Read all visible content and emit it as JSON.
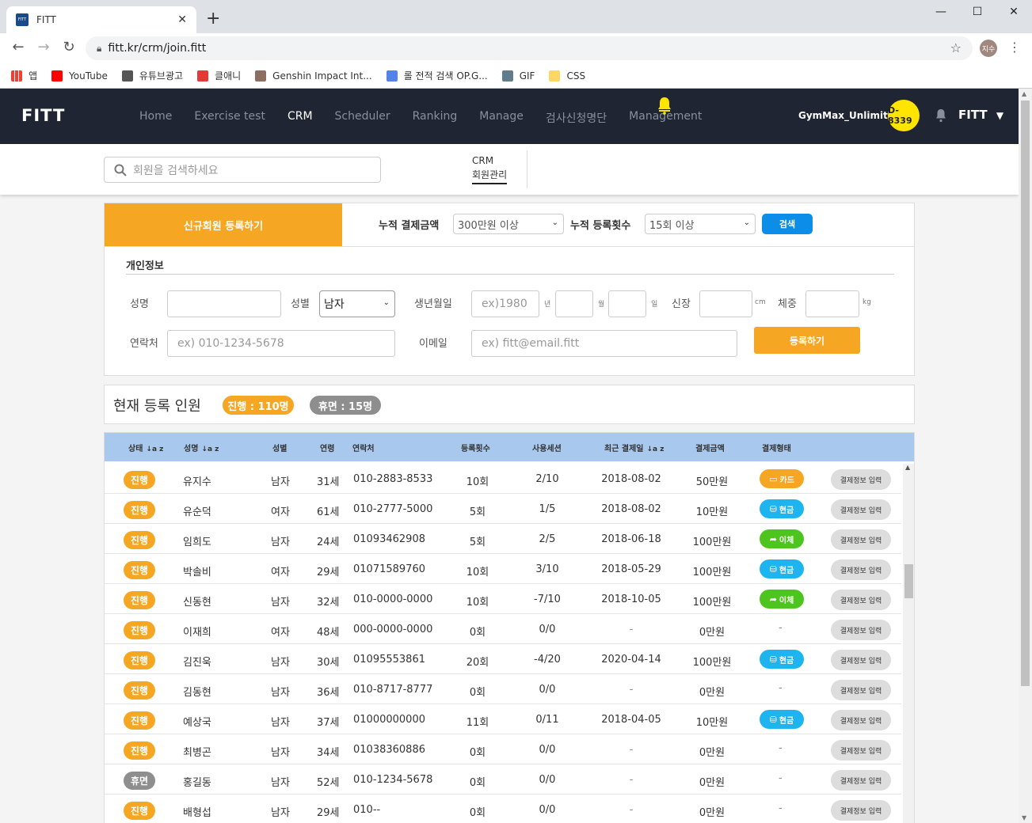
{
  "browser": {
    "tab_title": "FITT",
    "tab_favicon": "FITT",
    "url": "fitt.kr/crm/join.fitt",
    "profile": "지수",
    "bookmarks": [
      {
        "label": "앱",
        "icon": "apps-grid-icon",
        "color": "#4285f4"
      },
      {
        "label": "YouTube",
        "icon": "youtube-icon",
        "color": "#ff0000"
      },
      {
        "label": "유튜브광고",
        "icon": "globe-icon",
        "color": "#555555"
      },
      {
        "label": "클애니",
        "icon": "c-logo-icon",
        "color": "#e53935"
      },
      {
        "label": "Genshin Impact Int...",
        "icon": "genshin-icon",
        "color": "#8d6e63"
      },
      {
        "label": "롤 전적 검색 OP.G...",
        "icon": "opgg-icon",
        "color": "#5383e8"
      },
      {
        "label": "GIF",
        "icon": "gif-icon",
        "color": "#607d8b"
      },
      {
        "label": "CSS",
        "icon": "folder-icon",
        "color": "#fdd663"
      }
    ]
  },
  "header": {
    "logo": "FITT",
    "menu": [
      "Home",
      "Exercise test",
      "CRM",
      "Scheduler",
      "Ranking",
      "Manage",
      "검사신청명단",
      "Management"
    ],
    "active_menu": "CRM",
    "gym_name": "GymMax_Unlimited",
    "dday": "D-8339",
    "user": "FITT",
    "accent": "#ffe400",
    "nav_bg": "#1f2532"
  },
  "subbar": {
    "search_placeholder": "회원을 검색하세요",
    "crm_label": "CRM",
    "crm_sub": "회원관리"
  },
  "register": {
    "new_member_button": "신규회원 등록하기",
    "filter1_label": "누적 결제금액",
    "filter1_value": "300만원 이상",
    "filter2_label": "누적 등록횟수",
    "filter2_value": "15회 이상",
    "search_button": "검색",
    "section_title": "개인정보",
    "name_label": "성명",
    "gender_label": "성별",
    "gender_value": "남자",
    "birth_label": "생년월일",
    "birth_placeholder": "ex)1980",
    "year_unit": "년",
    "month_unit": "월",
    "day_unit": "일",
    "height_label": "신장",
    "height_unit": "cm",
    "weight_label": "체중",
    "weight_unit": "kg",
    "contact_label": "연락처",
    "contact_placeholder": "ex) 010-1234-5678",
    "email_label": "이메일",
    "email_placeholder": "ex) fitt@email.fitt",
    "submit_button": "등록하기",
    "orange": "#f5a623"
  },
  "counts": {
    "title": "현재 등록 인원",
    "active": "진행 : 110명",
    "dormant": "휴면 : 15명"
  },
  "table": {
    "headers": [
      "상태",
      "성명",
      "성별",
      "연령",
      "연락처",
      "등록횟수",
      "사용세션",
      "최근 결제일",
      "결제금액",
      "결제형태"
    ],
    "sort_icon": "↓a z",
    "action_label": "결제정보 입력",
    "rows": [
      {
        "status": "진행",
        "name": "유지수",
        "gender": "남자",
        "age": "31세",
        "phone": "010-2883-8533",
        "count": "10회",
        "session": "2/10",
        "date": "2018-08-02",
        "amount": "50만원",
        "ptype": "카드",
        "picon": "▭"
      },
      {
        "status": "진행",
        "name": "유순덕",
        "gender": "여자",
        "age": "61세",
        "phone": "010-2777-5000",
        "count": "5회",
        "session": "1/5",
        "date": "2018-08-02",
        "amount": "10만원",
        "ptype": "현금",
        "picon": "⛁"
      },
      {
        "status": "진행",
        "name": "임희도",
        "gender": "남자",
        "age": "24세",
        "phone": "01093462908",
        "count": "5회",
        "session": "2/5",
        "date": "2018-06-18",
        "amount": "100만원",
        "ptype": "이체",
        "picon": "➦"
      },
      {
        "status": "진행",
        "name": "박솔비",
        "gender": "여자",
        "age": "29세",
        "phone": "01071589760",
        "count": "10회",
        "session": "3/10",
        "date": "2018-05-29",
        "amount": "100만원",
        "ptype": "현금",
        "picon": "⛁"
      },
      {
        "status": "진행",
        "name": "신동현",
        "gender": "남자",
        "age": "32세",
        "phone": "010-0000-0000",
        "count": "10회",
        "session": "-7/10",
        "date": "2018-10-05",
        "amount": "100만원",
        "ptype": "이체",
        "picon": "➦"
      },
      {
        "status": "진행",
        "name": "이재희",
        "gender": "여자",
        "age": "48세",
        "phone": "000-0000-0000",
        "count": "0회",
        "session": "0/0",
        "date": "-",
        "amount": "0만원",
        "ptype": "-",
        "picon": ""
      },
      {
        "status": "진행",
        "name": "김진욱",
        "gender": "남자",
        "age": "30세",
        "phone": "01095553861",
        "count": "20회",
        "session": "-4/20",
        "date": "2020-04-14",
        "amount": "100만원",
        "ptype": "현금",
        "picon": "⛁"
      },
      {
        "status": "진행",
        "name": "김동현",
        "gender": "남자",
        "age": "36세",
        "phone": "010-8717-8777",
        "count": "0회",
        "session": "0/0",
        "date": "-",
        "amount": "0만원",
        "ptype": "-",
        "picon": ""
      },
      {
        "status": "진행",
        "name": "예상국",
        "gender": "남자",
        "age": "37세",
        "phone": "01000000000",
        "count": "11회",
        "session": "0/11",
        "date": "2018-04-05",
        "amount": "10만원",
        "ptype": "현금",
        "picon": "⛁"
      },
      {
        "status": "진행",
        "name": "최병곤",
        "gender": "남자",
        "age": "34세",
        "phone": "01038360886",
        "count": "0회",
        "session": "0/0",
        "date": "-",
        "amount": "0만원",
        "ptype": "-",
        "picon": ""
      },
      {
        "status": "휴면",
        "name": "홍길동",
        "gender": "남자",
        "age": "52세",
        "phone": "010-1234-5678",
        "count": "0회",
        "session": "0/0",
        "date": "-",
        "amount": "0만원",
        "ptype": "-",
        "picon": ""
      },
      {
        "status": "진행",
        "name": "배형섭",
        "gender": "남자",
        "age": "29세",
        "phone": "010--",
        "count": "0회",
        "session": "0/0",
        "date": "-",
        "amount": "0만원",
        "ptype": "-",
        "picon": ""
      }
    ],
    "colors": {
      "진행": "#f5a623",
      "휴면": "#8e8e8e",
      "카드": "#f5a623",
      "현금": "#1eb4f0",
      "이체": "#4ec51e"
    }
  }
}
